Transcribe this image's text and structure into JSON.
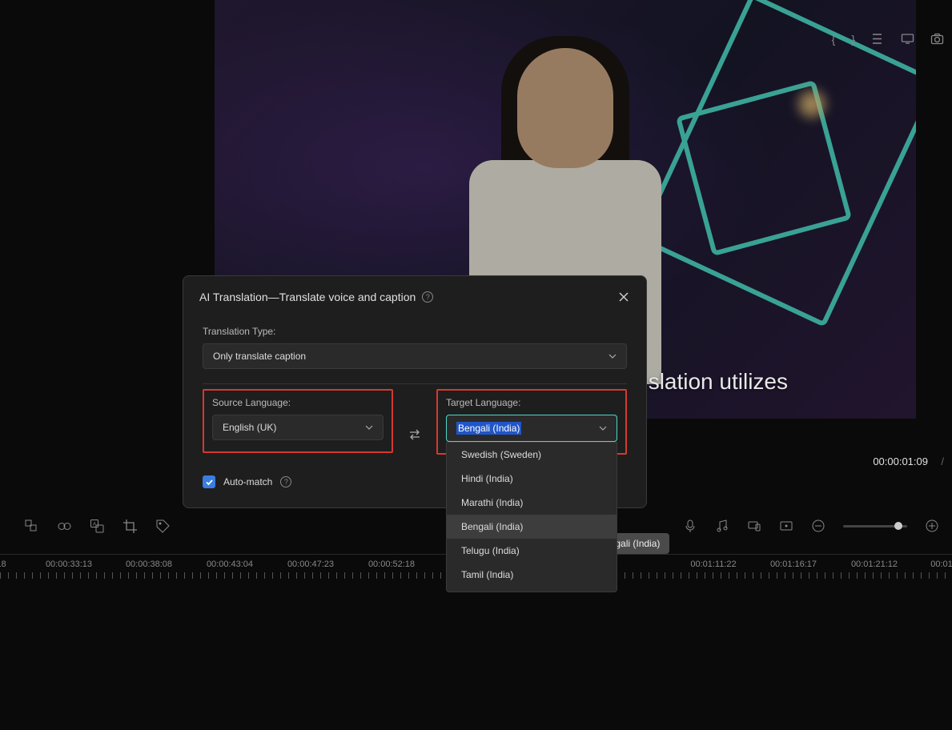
{
  "video": {
    "caption_text": "slation utilizes"
  },
  "modal": {
    "title": "AI Translation—Translate voice and caption",
    "translation_type_label": "Translation Type:",
    "translation_type_value": "Only translate caption",
    "source_label": "Source Language:",
    "source_value": "English (UK)",
    "target_label": "Target Language:",
    "target_value": "Bengali (India)",
    "target_options": [
      "Swedish (Sweden)",
      "Hindi (India)",
      "Marathi (India)",
      "Bengali (India)",
      "Telugu (India)",
      "Tamil (India)"
    ],
    "tooltip": "Bengali (India)",
    "automatch_label": "Auto-match"
  },
  "playback": {
    "current_time": "00:00:01:09"
  },
  "timeline": {
    "marks": [
      {
        "label": ":18",
        "pos": 0
      },
      {
        "label": "00:00:33:13",
        "pos": 86
      },
      {
        "label": "00:00:38:08",
        "pos": 186
      },
      {
        "label": "00:00:43:04",
        "pos": 287
      },
      {
        "label": "00:00:47:23",
        "pos": 388
      },
      {
        "label": "00:00:52:18",
        "pos": 489
      },
      {
        "label": "00:01:11:22",
        "pos": 891
      },
      {
        "label": "00:01:16:17",
        "pos": 991
      },
      {
        "label": "00:01:21:12",
        "pos": 1092
      },
      {
        "label": "00:01",
        "pos": 1176
      }
    ]
  }
}
